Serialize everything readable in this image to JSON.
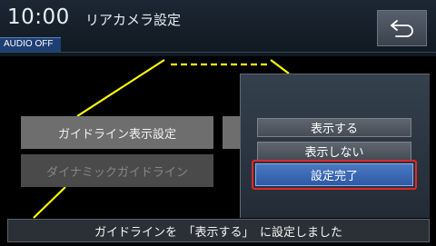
{
  "header": {
    "clock": "10:00",
    "title": "リアカメラ設定",
    "audio_status": "AUDIO OFF",
    "back_icon": "return-arrow-icon"
  },
  "menu": {
    "guideline_settings": "ガイドライン表示設定",
    "dynamic_guideline": "ダイナミックガイドライン"
  },
  "popup": {
    "options": [
      "表示する",
      "表示しない"
    ],
    "confirm": "設定完了"
  },
  "status_message": "ガイドラインを　「表示する」　に設定しました",
  "colors": {
    "guide_line": "#ffff00",
    "highlight": "#e0282c",
    "selected_button": "#3a68b6"
  }
}
